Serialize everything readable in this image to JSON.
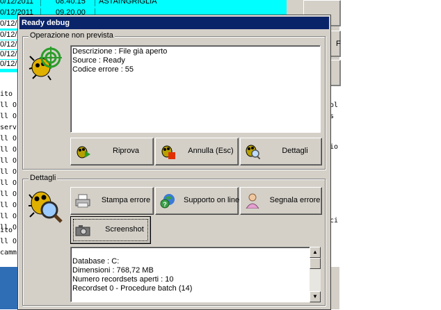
{
  "background": {
    "rows": [
      {
        "date": "0/12/2011",
        "time": "08.40.15",
        "name": "ASTAINGRIGLIA"
      },
      {
        "date": "0/12/2011",
        "time": "09.20.00",
        "name": ""
      },
      {
        "date": "0/12/",
        "time": "",
        "name": ""
      },
      {
        "date": "0/12/",
        "time": "",
        "name": ""
      },
      {
        "date": "0/12/",
        "time": "",
        "name": ""
      },
      {
        "date": "0/12/",
        "time": "",
        "name": ""
      },
      {
        "date": "0/12/",
        "time": "",
        "name": ""
      }
    ],
    "log_left": [
      "ito",
      "ll O",
      "ll O",
      "serv",
      "ll O",
      "ll O",
      "ll O",
      "ll O",
      "ll O",
      "ll O",
      "ll O",
      "ll O",
      "ll O",
      "ito",
      "ll O",
      "camm"
    ],
    "log_right": [
      "ol",
      "s",
      "io",
      "ci"
    ],
    "right_panel_letter": "F"
  },
  "dialog": {
    "title": "Ready debug",
    "group1": {
      "label": "Operazione non prevista",
      "icon": "bug-target-icon",
      "lines": [
        "Descrizione : File già aperto",
        "Source : Ready",
        "Codice errore : 55"
      ],
      "buttons": [
        {
          "label": "Riprova",
          "icon": "bug-retry-icon"
        },
        {
          "label": "Annulla (Esc)",
          "icon": "bug-cancel-icon"
        },
        {
          "label": "Dettagli",
          "icon": "bug-magnifier-icon"
        }
      ]
    },
    "group2": {
      "label": "Dettagli",
      "icon": "bug-magnifier-icon",
      "buttons": [
        {
          "label": "Stampa errore",
          "icon": "printer-icon"
        },
        {
          "label": "Supporto on line",
          "icon": "globe-help-icon"
        },
        {
          "label": "Segnala errore",
          "icon": "person-report-icon"
        },
        {
          "label": "Screenshot",
          "icon": "camera-icon"
        }
      ],
      "lines": [
        "Database : C:",
        "Dimensioni : 768,72 MB",
        "Numero recordsets aperti : 10",
        "Recordset 0 - Procedure batch (14)"
      ]
    }
  },
  "colors": {
    "titlebar": "#0a246a",
    "dialog_bg": "#d4d0c8",
    "grid_bg": "#00ffff"
  }
}
